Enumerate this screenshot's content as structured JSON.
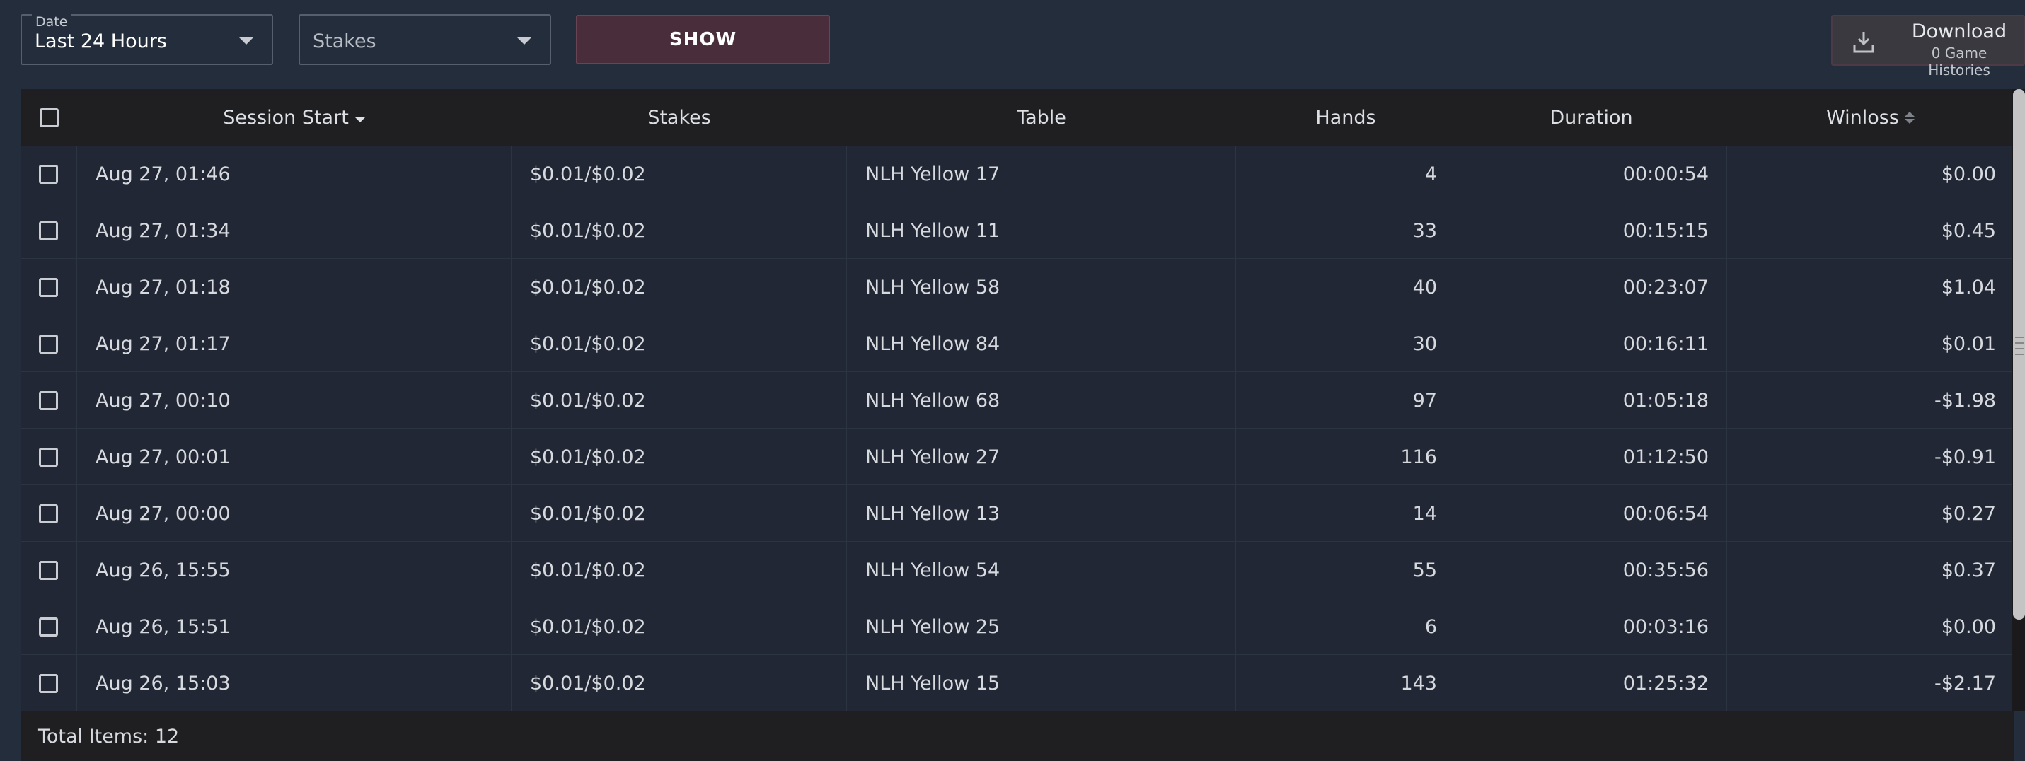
{
  "filters": {
    "date": {
      "legend": "Date",
      "value": "Last 24 Hours"
    },
    "stakes": {
      "placeholder": "Stakes"
    },
    "show_label": "SHOW"
  },
  "download": {
    "title": "Download",
    "subtitle": "0 Game Histories"
  },
  "table": {
    "columns": {
      "session_start": "Session Start",
      "stakes": "Stakes",
      "table": "Table",
      "hands": "Hands",
      "duration": "Duration",
      "winloss": "Winloss"
    },
    "rows": [
      {
        "session_start": "Aug 27, 01:46",
        "stakes": "$0.01/$0.02",
        "table": "NLH Yellow 17",
        "hands": "4",
        "duration": "00:00:54",
        "winloss": "$0.00"
      },
      {
        "session_start": "Aug 27, 01:34",
        "stakes": "$0.01/$0.02",
        "table": "NLH Yellow 11",
        "hands": "33",
        "duration": "00:15:15",
        "winloss": "$0.45"
      },
      {
        "session_start": "Aug 27, 01:18",
        "stakes": "$0.01/$0.02",
        "table": "NLH Yellow 58",
        "hands": "40",
        "duration": "00:23:07",
        "winloss": "$1.04"
      },
      {
        "session_start": "Aug 27, 01:17",
        "stakes": "$0.01/$0.02",
        "table": "NLH Yellow 84",
        "hands": "30",
        "duration": "00:16:11",
        "winloss": "$0.01"
      },
      {
        "session_start": "Aug 27, 00:10",
        "stakes": "$0.01/$0.02",
        "table": "NLH Yellow 68",
        "hands": "97",
        "duration": "01:05:18",
        "winloss": "-$1.98"
      },
      {
        "session_start": "Aug 27, 00:01",
        "stakes": "$0.01/$0.02",
        "table": "NLH Yellow 27",
        "hands": "116",
        "duration": "01:12:50",
        "winloss": "-$0.91"
      },
      {
        "session_start": "Aug 27, 00:00",
        "stakes": "$0.01/$0.02",
        "table": "NLH Yellow 13",
        "hands": "14",
        "duration": "00:06:54",
        "winloss": "$0.27"
      },
      {
        "session_start": "Aug 26, 15:55",
        "stakes": "$0.01/$0.02",
        "table": "NLH Yellow 54",
        "hands": "55",
        "duration": "00:35:56",
        "winloss": "$0.37"
      },
      {
        "session_start": "Aug 26, 15:51",
        "stakes": "$0.01/$0.02",
        "table": "NLH Yellow 25",
        "hands": "6",
        "duration": "00:03:16",
        "winloss": "$0.00"
      },
      {
        "session_start": "Aug 26, 15:03",
        "stakes": "$0.01/$0.02",
        "table": "NLH Yellow 15",
        "hands": "143",
        "duration": "01:25:32",
        "winloss": "-$2.17"
      }
    ],
    "footer": "Total Items: 12"
  },
  "colors": {
    "background": "#232d3b",
    "header_bg": "#1f1f21",
    "show_button": "#4a2d3b"
  },
  "icons": {
    "download": "download-tray-icon",
    "sort_active": "sort-descending-icon",
    "sort_inactive": "sort-both-icon"
  }
}
